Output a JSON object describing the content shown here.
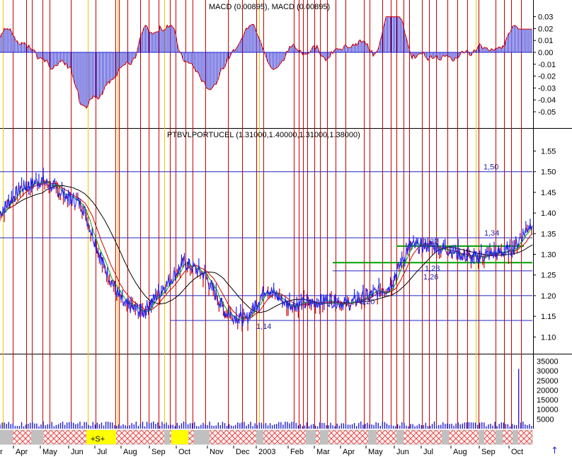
{
  "colors": {
    "price": "#1f1ff0",
    "ma_fast": "#00a000",
    "ma_mid": "#d00000",
    "ma_slow": "#000000",
    "event_line": "#c80000",
    "event_line_alt": "#f0c800",
    "level_line": "#2020c0",
    "channel": "#00a000",
    "macd_hist": "#2020d0",
    "volume": "#2020d0",
    "signal_yellow": "#ffff00",
    "signal_gray": "#c0c0c0",
    "signal_hatch": "#e03030"
  },
  "macd_panel": {
    "title": "MACD (0.00895), MACD (0.00895)",
    "y_ticks": [
      "0.03",
      "0.02",
      "0.01",
      "0.00",
      "-0.01",
      "-0.02",
      "-0.03",
      "-0.04",
      "-0.05"
    ]
  },
  "price_panel": {
    "title": "PTBVLPORTUCEL (1.31000,1.40000,1.31000,1.38000)",
    "y_ticks": [
      "1.55",
      "1.50",
      "1.45",
      "1.40",
      "1.35",
      "1.30",
      "1.25",
      "1.20",
      "1.15",
      "1.10"
    ],
    "level_labels": [
      "1,50",
      "1,34",
      "1,32",
      "1,28",
      "1,26",
      "1,20",
      "1,14"
    ]
  },
  "volume_panel": {
    "y_ticks": [
      "35000",
      "30000",
      "25000",
      "20000",
      "15000",
      "10000",
      "5000"
    ]
  },
  "x_axis": {
    "months": [
      "r",
      "Apr",
      "May",
      "Jun",
      "Jul",
      "Aug",
      "Sep",
      "Oct",
      "Nov",
      "Dec",
      "2003",
      "Feb",
      "Mar",
      "Apr",
      "May",
      "Jun",
      "Jul",
      "Aug",
      "Sep",
      "Oct"
    ]
  },
  "signal_strip": {
    "label": "+S+"
  },
  "icons": {
    "scroll": "up-arrow-icon",
    "scroll_glyph": "↑"
  },
  "chart_data": {
    "type": "line",
    "series": [
      {
        "name": "PTBVLPORTUCEL",
        "values": [
          [
            "Apr",
            1.4
          ],
          [
            "May",
            1.46
          ],
          [
            "May",
            1.48
          ],
          [
            "Jun",
            1.45
          ],
          [
            "Jun",
            1.42
          ],
          [
            "Jul",
            1.28
          ],
          [
            "Jul",
            1.18
          ],
          [
            "Aug",
            1.16
          ],
          [
            "Aug",
            1.22
          ],
          [
            "Sep",
            1.28
          ],
          [
            "Sep",
            1.25
          ],
          [
            "Oct",
            1.16
          ],
          [
            "Oct",
            1.14
          ],
          [
            "Nov",
            1.22
          ],
          [
            "Nov",
            1.18
          ],
          [
            "Dec",
            1.18
          ],
          [
            "2003",
            1.19
          ],
          [
            "Feb",
            1.18
          ],
          [
            "Mar",
            1.2
          ],
          [
            "Apr",
            1.22
          ],
          [
            "May",
            1.32
          ],
          [
            "Jun",
            1.32
          ],
          [
            "Jul",
            1.31
          ],
          [
            "Aug",
            1.29
          ],
          [
            "Sep",
            1.3
          ],
          [
            "Oct",
            1.31
          ],
          [
            "Oct",
            1.38
          ]
        ]
      }
    ],
    "ylim": [
      1.08,
      1.58
    ],
    "levels": [
      1.5,
      1.34,
      1.32,
      1.28,
      1.26,
      1.2,
      1.14
    ],
    "macd_ylim": [
      -0.055,
      0.035
    ],
    "volume_ylim": [
      0,
      37000
    ],
    "grid": false,
    "legend": "none"
  }
}
